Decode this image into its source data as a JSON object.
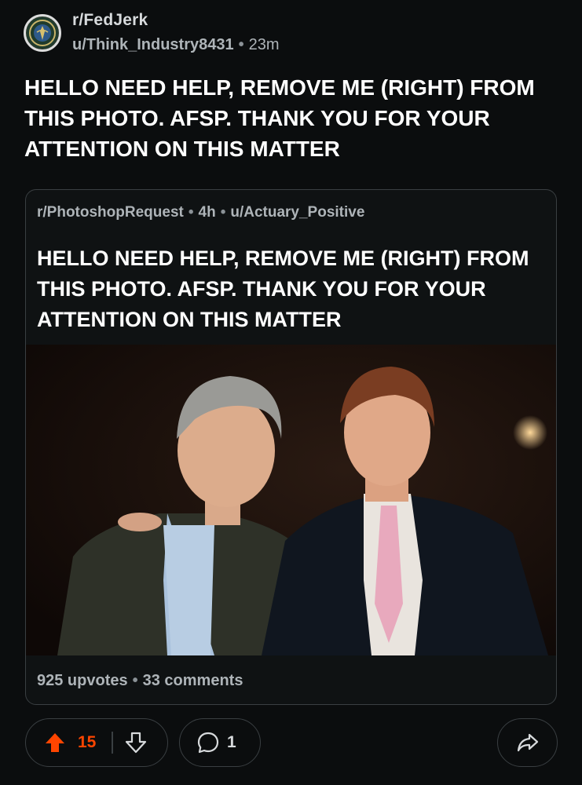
{
  "post": {
    "subreddit": "r/FedJerk",
    "author": "u/Think_Industry8431",
    "separator": "•",
    "age": "23m",
    "title": "HELLO NEED HELP, REMOVE ME (RIGHT) FROM THIS PHOTO. AFSP. THANK YOU FOR YOUR ATTENTION ON THIS MATTER",
    "avatar_icon": "seal-icon"
  },
  "crosspost": {
    "subreddit": "r/PhotoshopRequest",
    "separator": "•",
    "age": "4h",
    "author": "u/Actuary_Positive",
    "title": "HELLO NEED HELP, REMOVE ME (RIGHT) FROM THIS PHOTO. AFSP. THANK YOU FOR YOUR ATTENTION ON THIS MATTER",
    "upvotes": "925 upvotes",
    "comments": "33 comments"
  },
  "actions": {
    "vote_count": "15",
    "comment_count": "1",
    "upvote_icon": "upvote-arrow-icon",
    "downvote_icon": "downvote-arrow-icon",
    "comment_icon": "comment-bubble-icon",
    "share_icon": "share-arrow-icon",
    "upvote_color": "#ff4500"
  },
  "colors": {
    "background": "#0b0d0e",
    "text_primary": "#ffffff",
    "text_secondary": "#aeb4b8",
    "border": "#3a3f42",
    "accent": "#ff4500"
  }
}
